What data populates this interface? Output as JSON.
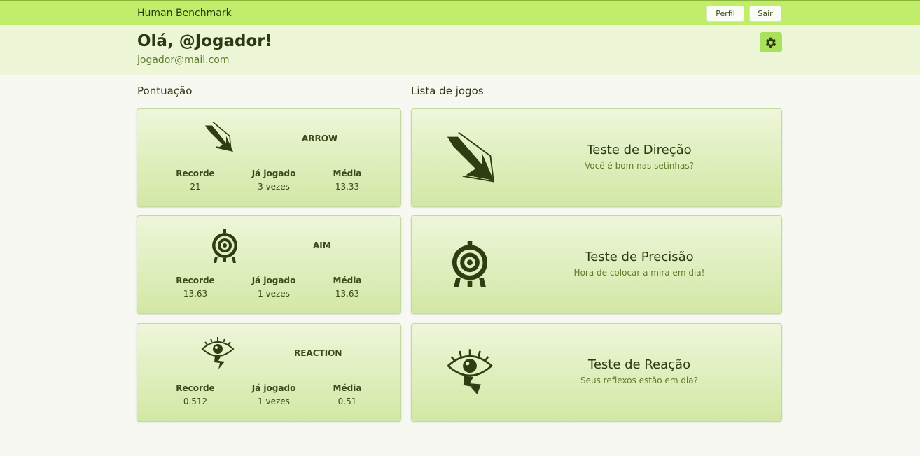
{
  "nav": {
    "brand": "Human Benchmark",
    "profile_label": "Perfil",
    "logout_label": "Sair"
  },
  "header": {
    "greeting": "Olá, @Jogador!",
    "email": "jogador@mail.com",
    "settings_icon": "gear-icon"
  },
  "scores": {
    "title": "Pontuação",
    "labels": {
      "record": "Recorde",
      "played": "Já jogado",
      "average": "Média"
    },
    "items": [
      {
        "name": "ARROW",
        "icon": "arrow-icon",
        "record": "21",
        "played": "3 vezes",
        "average": "13.33"
      },
      {
        "name": "AIM",
        "icon": "target-icon",
        "record": "13.63",
        "played": "1 vezes",
        "average": "13.63"
      },
      {
        "name": "REACTION",
        "icon": "eye-lightning-icon",
        "record": "0.512",
        "played": "1 vezes",
        "average": "0.51"
      }
    ]
  },
  "games": {
    "title": "Lista de jogos",
    "items": [
      {
        "title": "Teste de Direção",
        "subtitle": "Você é bom nas setinhas?",
        "icon": "arrow-icon"
      },
      {
        "title": "Teste de Precisão",
        "subtitle": "Hora de colocar a mira em dia!",
        "icon": "target-icon"
      },
      {
        "title": "Teste de Reação",
        "subtitle": "Seus reflexos estão em dia?",
        "icon": "eye-lightning-icon"
      }
    ]
  },
  "colors": {
    "topbar": "#c0ee6a",
    "hero": "#eef6d8",
    "accent": "#a9e25a",
    "text_dark": "#2b3a10",
    "text_muted": "#5e7b2b"
  }
}
